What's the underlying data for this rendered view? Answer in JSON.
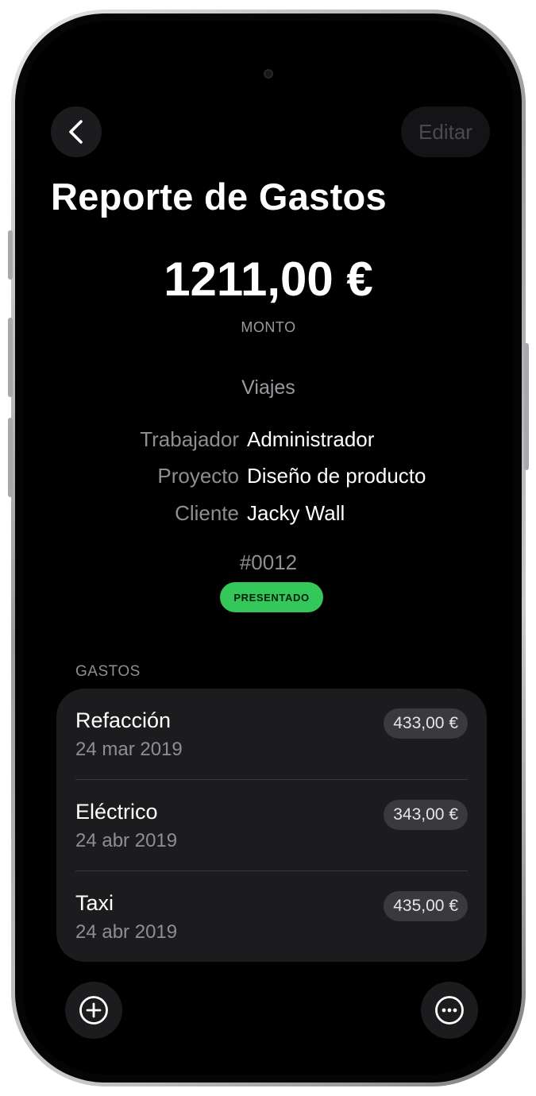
{
  "nav": {
    "edit_label": "Editar"
  },
  "report": {
    "title": "Reporte de Gastos",
    "amount": "1211,00 €",
    "amount_label": "MONTO",
    "category": "Viajes",
    "details": [
      {
        "key": "Trabajador",
        "value": "Administrador"
      },
      {
        "key": "Proyecto",
        "value": "Diseño de producto"
      },
      {
        "key": "Cliente",
        "value": "Jacky Wall"
      }
    ],
    "reference": "#0012",
    "status": "PRESENTADO",
    "status_color": "#34c759"
  },
  "expenses": {
    "section_title": "GASTOS",
    "items": [
      {
        "name": "Refacción",
        "date": "24 mar 2019",
        "amount": "433,00 €"
      },
      {
        "name": "Eléctrico",
        "date": "24 abr 2019",
        "amount": "343,00 €"
      },
      {
        "name": "Taxi",
        "date": "24 abr 2019",
        "amount": "435,00 €"
      }
    ]
  },
  "icons": {
    "back": "chevron-left-icon",
    "add": "plus-circle-icon",
    "more": "ellipsis-circle-icon"
  }
}
